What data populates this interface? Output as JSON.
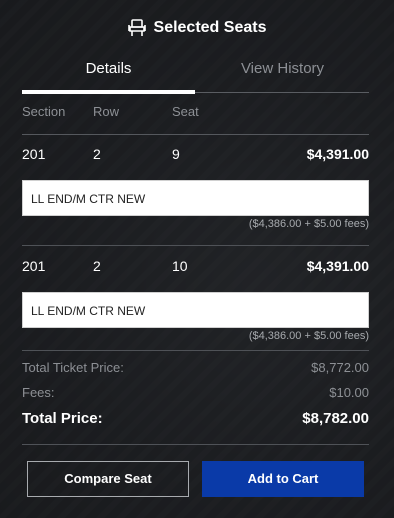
{
  "header": {
    "title": "Selected Seats",
    "icon": "seat-icon"
  },
  "tabs": [
    {
      "label": "Details",
      "active": true
    },
    {
      "label": "View History",
      "active": false
    }
  ],
  "columns": {
    "section": "Section",
    "row": "Row",
    "seat": "Seat"
  },
  "tickets": [
    {
      "section": "201",
      "row": "2",
      "seat": "9",
      "price": "$4,391.00",
      "note": "LL END/M CTR NEW",
      "fees": "($4,386.00 + $5.00 fees)"
    },
    {
      "section": "201",
      "row": "2",
      "seat": "10",
      "price": "$4,391.00",
      "note": "LL END/M CTR NEW",
      "fees": "($4,386.00 + $5.00 fees)"
    }
  ],
  "totals": {
    "ticket_label": "Total Ticket Price:",
    "ticket_value": "$8,772.00",
    "fees_label": "Fees:",
    "fees_value": "$10.00",
    "total_label": "Total Price:",
    "total_value": "$8,782.00"
  },
  "buttons": {
    "compare": "Compare Seat",
    "cart": "Add to Cart"
  },
  "colors": {
    "accent": "#0a3aa8",
    "background": "#1e2023"
  }
}
